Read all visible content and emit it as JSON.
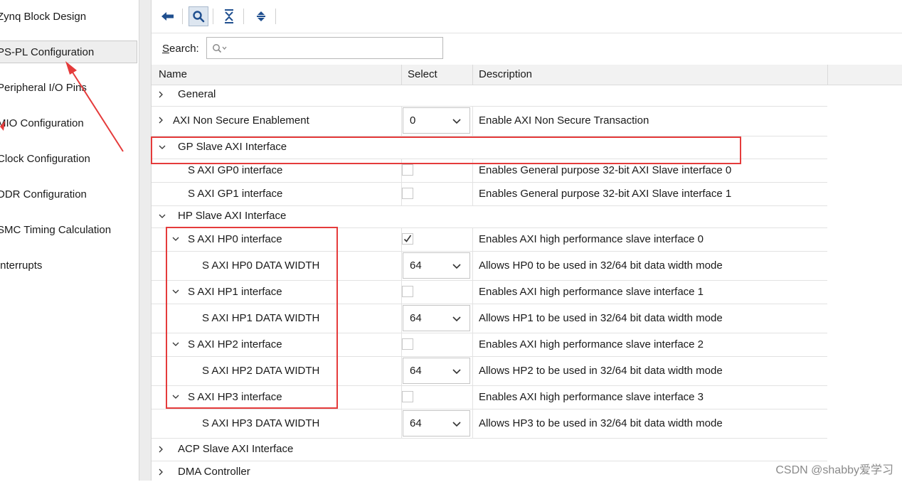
{
  "nav": {
    "items": [
      {
        "label": "Zynq Block Design"
      },
      {
        "label": "PS-PL Configuration"
      },
      {
        "label": "Peripheral I/O Pins"
      },
      {
        "label": "MIO Configuration"
      },
      {
        "label": "Clock Configuration"
      },
      {
        "label": "DDR Configuration"
      },
      {
        "label": "SMC Timing Calculation"
      },
      {
        "label": "Interrupts"
      }
    ],
    "selected": "PS-PL Configuration"
  },
  "toolbar": {
    "buttons": [
      "back-icon",
      "search-icon",
      "collapse-all-icon",
      "expand-all-icon"
    ]
  },
  "search": {
    "label_first": "S",
    "label_rest": "earch:",
    "placeholder": ""
  },
  "table": {
    "headers": {
      "name": "Name",
      "select": "Select",
      "description": "Description"
    },
    "rows": [
      {
        "name": "General",
        "select": "",
        "description": ""
      },
      {
        "name": "AXI Non Secure Enablement",
        "select": "0",
        "description": "Enable AXI Non Secure Transaction"
      },
      {
        "name": "GP Slave AXI Interface",
        "select": "",
        "description": ""
      },
      {
        "name": "S AXI GP0 interface",
        "select": "",
        "description": "Enables General purpose 32-bit AXI Slave interface 0"
      },
      {
        "name": "S AXI GP1 interface",
        "select": "",
        "description": "Enables General purpose 32-bit AXI Slave interface 1"
      },
      {
        "name": "HP Slave AXI Interface",
        "select": "",
        "description": ""
      },
      {
        "name": "S AXI HP0 interface",
        "select": "checked",
        "description": "Enables AXI high performance slave interface 0"
      },
      {
        "name": "S AXI HP0 DATA WIDTH",
        "select": "64",
        "description": "Allows HP0 to be used in 32/64 bit data width mode"
      },
      {
        "name": "S AXI HP1 interface",
        "select": "",
        "description": "Enables AXI high performance slave interface 1"
      },
      {
        "name": "S AXI HP1 DATA WIDTH",
        "select": "64",
        "description": "Allows HP1 to be used in 32/64 bit data width mode"
      },
      {
        "name": "S AXI HP2 interface",
        "select": "",
        "description": "Enables AXI high performance slave interface 2"
      },
      {
        "name": "S AXI HP2 DATA WIDTH",
        "select": "64",
        "description": "Allows HP2 to be used in 32/64 bit data width mode"
      },
      {
        "name": "S AXI HP3 interface",
        "select": "",
        "description": "Enables AXI high performance slave interface 3"
      },
      {
        "name": "S AXI HP3 DATA WIDTH",
        "select": "64",
        "description": "Allows HP3 to be used in 32/64 bit data width mode"
      },
      {
        "name": "ACP Slave AXI Interface",
        "select": "",
        "description": ""
      },
      {
        "name": "DMA Controller",
        "select": "",
        "description": ""
      }
    ]
  },
  "annotations": {
    "color": "#e53b3b"
  },
  "watermark": "CSDN @shabby爱学习"
}
